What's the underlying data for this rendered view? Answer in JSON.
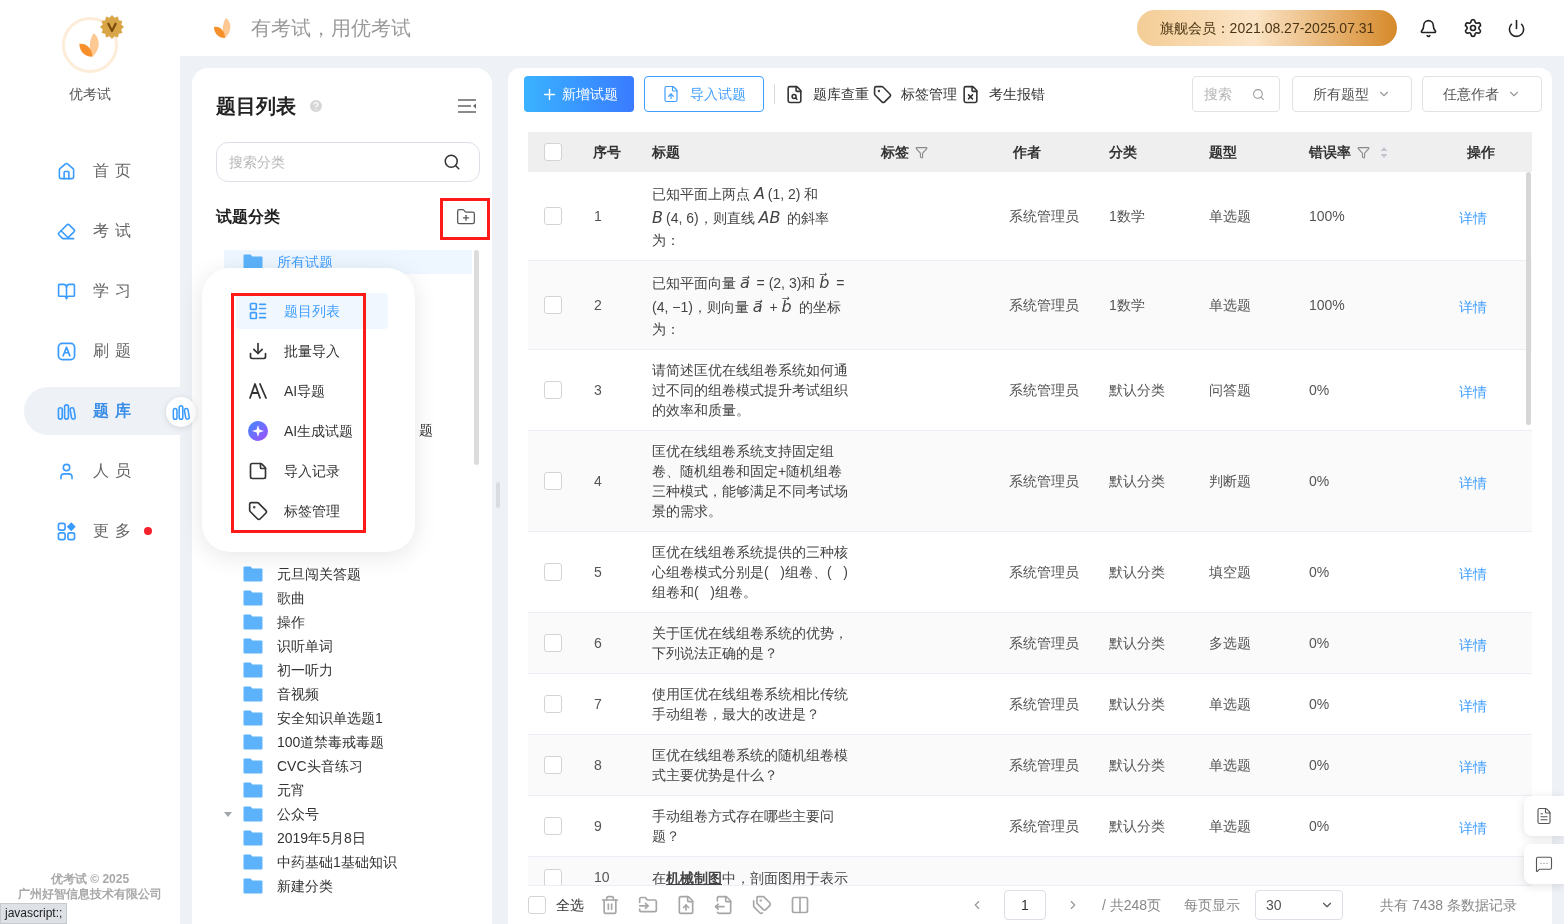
{
  "sidebar": {
    "brand": "优考试",
    "nav": [
      {
        "label": "首页",
        "selected": false
      },
      {
        "label": "考试",
        "selected": false
      },
      {
        "label": "学习",
        "selected": false
      },
      {
        "label": "刷题",
        "selected": false
      },
      {
        "label": "题库",
        "selected": true
      },
      {
        "label": "人员",
        "selected": false
      },
      {
        "label": "更多",
        "selected": false,
        "dot": true
      }
    ],
    "footer": [
      "优考试 © 2025",
      "广州好智信息技术有限公司"
    ]
  },
  "header": {
    "slogan": "有考试，用优考试",
    "membership": "旗舰会员：2021.08.27-2025.07.31"
  },
  "category_panel": {
    "title": "题目列表",
    "search": {
      "placeholder": "搜索分类"
    },
    "section_title": "试题分类",
    "tree": [
      {
        "label": "所有试题",
        "selected": true
      },
      {
        "label": "元旦闯关答题",
        "selected": false
      },
      {
        "label": "歌曲",
        "selected": false
      },
      {
        "label": "操作",
        "selected": false
      },
      {
        "label": "识听单词",
        "selected": false
      },
      {
        "label": "初一听力",
        "selected": false
      },
      {
        "label": "音视频",
        "selected": false
      },
      {
        "label": "安全知识单选题1",
        "selected": false
      },
      {
        "label": "100道禁毒戒毒题",
        "selected": false
      },
      {
        "label": "CVC头音练习",
        "selected": false
      },
      {
        "label": "元宵",
        "selected": false
      },
      {
        "label": "公众号",
        "selected": false,
        "expanded": true
      },
      {
        "label": "2019年5月8日",
        "selected": false
      },
      {
        "label": "中药基础1基础知识",
        "selected": false
      },
      {
        "label": "新建分类",
        "selected": false
      }
    ],
    "covered_fragment": "题"
  },
  "popup_menu": {
    "items": [
      {
        "label": "题目列表",
        "selected": true
      },
      {
        "label": "批量导入",
        "selected": false
      },
      {
        "label": "AI导题",
        "selected": false
      },
      {
        "label": "AI生成试题",
        "selected": false
      },
      {
        "label": "导入记录",
        "selected": false
      },
      {
        "label": "标签管理",
        "selected": false
      }
    ]
  },
  "toolbar": {
    "add_button": "新增试题",
    "import_button": "导入试题",
    "links": [
      "题库查重",
      "标签管理",
      "考生报错"
    ],
    "search": {
      "placeholder": "搜索"
    },
    "filters": [
      "所有题型",
      "任意作者"
    ]
  },
  "table": {
    "header_checked": false,
    "columns": [
      {
        "label": "序号"
      },
      {
        "label": "标题"
      },
      {
        "label": "标签",
        "filter": true
      },
      {
        "label": "作者"
      },
      {
        "label": "分类"
      },
      {
        "label": "题型"
      },
      {
        "label": "错误率",
        "filter": true,
        "sortable": true
      },
      {
        "label": "操作"
      }
    ],
    "rows": [
      {
        "checked": false,
        "number": "1",
        "title": "已知平面上两点 *A*(1, 2) 和 *B*(4, 6)，则直线 *AB* 的斜率为：",
        "author": "系统管理员",
        "category": "1数学",
        "type": "单选题",
        "error_rate": "100%",
        "action": "详情"
      },
      {
        "checked": false,
        "number": "2",
        "title": "已知平面向量 *a⃗* = (2, 3)和 *b⃗* = (4, −1)，则向量 *a⃗* + *b⃗* 的坐标为：",
        "author": "系统管理员",
        "category": "1数学",
        "type": "单选题",
        "error_rate": "100%",
        "action": "详情"
      },
      {
        "checked": false,
        "number": "3",
        "title": "请简述匡优在线组卷系统如何通过不同的组卷模式提升考试组织的效率和质量。",
        "author": "系统管理员",
        "category": "默认分类",
        "type": "问答题",
        "error_rate": "0%",
        "action": "详情"
      },
      {
        "checked": false,
        "number": "4",
        "title": "匡优在线组卷系统支持固定组卷、随机组卷和固定+随机组卷三种模式，能够满足不同考试场景的需求。",
        "author": "系统管理员",
        "category": "默认分类",
        "type": "判断题",
        "error_rate": "0%",
        "action": "详情"
      },
      {
        "checked": false,
        "number": "5",
        "title": "匡优在线组卷系统提供的三种核心组卷模式分别是(   )组卷、(   )组卷和(   )组卷。",
        "author": "系统管理员",
        "category": "默认分类",
        "type": "填空题",
        "error_rate": "0%",
        "action": "详情"
      },
      {
        "checked": false,
        "number": "6",
        "title": "关于匡优在线组卷系统的优势，下列说法正确的是？",
        "author": "系统管理员",
        "category": "默认分类",
        "type": "多选题",
        "error_rate": "0%",
        "action": "详情"
      },
      {
        "checked": false,
        "number": "7",
        "title": "使用匡优在线组卷系统相比传统手动组卷，最大的改进是？",
        "author": "系统管理员",
        "category": "默认分类",
        "type": "单选题",
        "error_rate": "0%",
        "action": "详情"
      },
      {
        "checked": false,
        "number": "8",
        "title": "匡优在线组卷系统的随机组卷模式主要优势是什么？",
        "author": "系统管理员",
        "category": "默认分类",
        "type": "单选题",
        "error_rate": "0%",
        "action": "详情"
      },
      {
        "checked": false,
        "number": "9",
        "title": "手动组卷方式存在哪些主要问题？",
        "author": "系统管理员",
        "category": "默认分类",
        "type": "单选题",
        "error_rate": "0%",
        "action": "详情"
      },
      {
        "checked": false,
        "number": "10",
        "title": "在**机械制图**中，剖面图用于表示"
      }
    ]
  },
  "footer": {
    "select_all": {
      "label": "全选",
      "checked": false
    },
    "page": "1",
    "total_pages": "/ 共248页",
    "page_size_label": "每页显示",
    "page_size": "30",
    "total": "共有 7438 条数据记录"
  },
  "status_url": "javascript:;"
}
